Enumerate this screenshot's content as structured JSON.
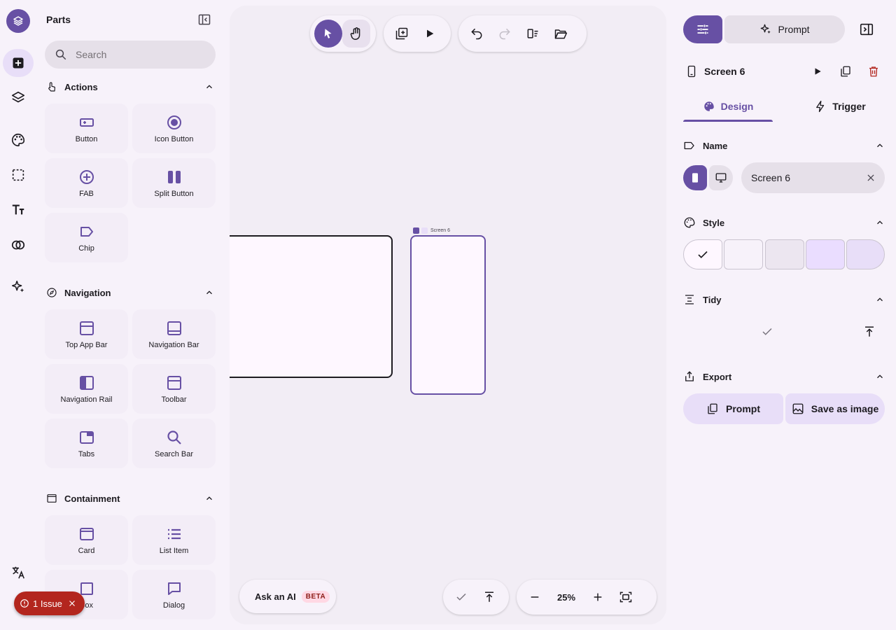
{
  "rail": {
    "items": [
      {
        "name": "add-icon"
      },
      {
        "name": "layers-icon"
      },
      {
        "name": "palette-icon"
      },
      {
        "name": "selection-icon"
      },
      {
        "name": "typography-icon"
      },
      {
        "name": "components-icon"
      },
      {
        "name": "sparkle-icon"
      },
      {
        "name": "translate-icon"
      }
    ]
  },
  "parts": {
    "title": "Parts",
    "search_placeholder": "Search",
    "sections": [
      {
        "label": "Actions",
        "items": [
          "Button",
          "Icon Button",
          "FAB",
          "Split Button",
          "Chip"
        ]
      },
      {
        "label": "Navigation",
        "items": [
          "Top App Bar",
          "Navigation Bar",
          "Navigation Rail",
          "Toolbar",
          "Tabs",
          "Search Bar"
        ]
      },
      {
        "label": "Containment",
        "items": [
          "Card",
          "List Item",
          "Box",
          "Dialog"
        ]
      }
    ]
  },
  "canvas": {
    "frame_label": "Screen 6",
    "ask_ai": "Ask an AI",
    "beta": "BETA",
    "zoom": "25%"
  },
  "issue": {
    "label": "1 Issue"
  },
  "right": {
    "prompt_label": "Prompt",
    "screen_name": "Screen 6",
    "tabs": {
      "design": "Design",
      "trigger": "Trigger"
    },
    "sections": {
      "name": "Name",
      "style": "Style",
      "tidy": "Tidy",
      "export": "Export"
    },
    "name_value": "Screen 6",
    "swatches": [
      "#fef7ff",
      "#f7f2fa",
      "#ece6f0",
      "#eaddff",
      "#e8def8"
    ],
    "export_prompt": "Prompt",
    "export_image": "Save as image"
  },
  "colors": {
    "primary": "#6750a4",
    "error": "#b3261e",
    "surface": "#f7f2fa"
  }
}
